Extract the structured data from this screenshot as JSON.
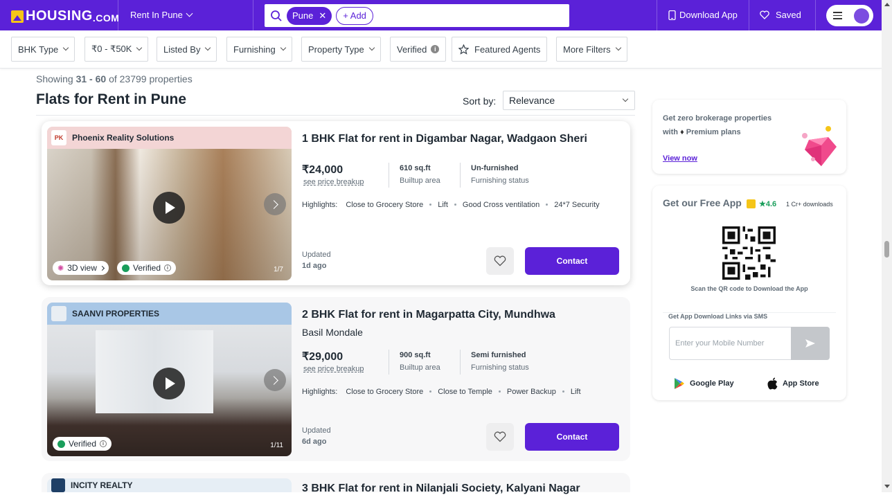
{
  "header": {
    "logo": "HOUSING",
    "logo_suffix": ".COM",
    "city_select": "Rent In Pune",
    "search_chip": "Pune",
    "add_chip": "+ Add",
    "download_app": "Download App",
    "saved": "Saved"
  },
  "filters": {
    "bhk": "BHK Type",
    "budget": "₹0 - ₹50K",
    "listed_by": "Listed By",
    "furnishing": "Furnishing",
    "property_type": "Property Type",
    "verified": "Verified",
    "featured_agents": "Featured Agents",
    "more_filters": "More Filters"
  },
  "results": {
    "showing_prefix": "Showing",
    "range": "31 - 60",
    "of_text": "of 23799 properties",
    "title": "Flats for Rent in Pune",
    "sort_label": "Sort by:",
    "sort_value": "Relevance"
  },
  "listings": [
    {
      "agent": "Phoenix Reality Solutions",
      "agent_logo": "PK",
      "title": "1 BHK Flat for rent in Digambar Nagar, Wadgaon Sheri",
      "price": "₹24,000",
      "price_link": "see price breakup",
      "area": "610 sq.ft",
      "area_label": "Builtup area",
      "furnishing": "Un-furnished",
      "furnishing_label": "Furnishing status",
      "highlights_label": "Highlights:",
      "highlights": [
        "Close to Grocery Store",
        "Lift",
        "Good Cross ventilation",
        "24*7 Security"
      ],
      "badge_3d": "3D view",
      "badge_verified": "Verified",
      "counter": "1/7",
      "updated_label": "Updated",
      "updated_value": "1d ago",
      "contact": "Contact"
    },
    {
      "agent": "SAANVI PROPERTIES",
      "title": "2 BHK Flat for rent in Magarpatta City, Mundhwa",
      "subtitle": "Basil Mondale",
      "price": "₹29,000",
      "price_link": "see price breakup",
      "area": "900 sq.ft",
      "area_label": "Builtup area",
      "furnishing": "Semi furnished",
      "furnishing_label": "Furnishing status",
      "highlights_label": "Highlights:",
      "highlights": [
        "Close to Grocery Store",
        "Close to Temple",
        "Power Backup",
        "Lift"
      ],
      "badge_verified": "Verified",
      "counter": "1/11",
      "updated_label": "Updated",
      "updated_value": "6d ago",
      "contact": "Contact"
    },
    {
      "agent": "INCITY REALTY",
      "title": "3 BHK Flat for rent in Nilanjali Society, Kalyani Nagar"
    }
  ],
  "promo": {
    "line1": "Get zero brokerage properties",
    "line2_prefix": "with",
    "line2_suffix": "Premium plans",
    "link": "View now"
  },
  "app_card": {
    "title": "Get our Free App",
    "rating": "4.6",
    "downloads": "1 Cr+ downloads",
    "qr_caption": "Scan the QR code to Download the App",
    "sms_label": "Get App Download Links via SMS",
    "mobile_placeholder": "Enter your Mobile Number",
    "google_play": "Google Play",
    "app_store": "App Store"
  },
  "colors": {
    "brand": "#5b21d8",
    "logo_yellow": "#f5c518",
    "verified_green": "#1a9e5b"
  }
}
